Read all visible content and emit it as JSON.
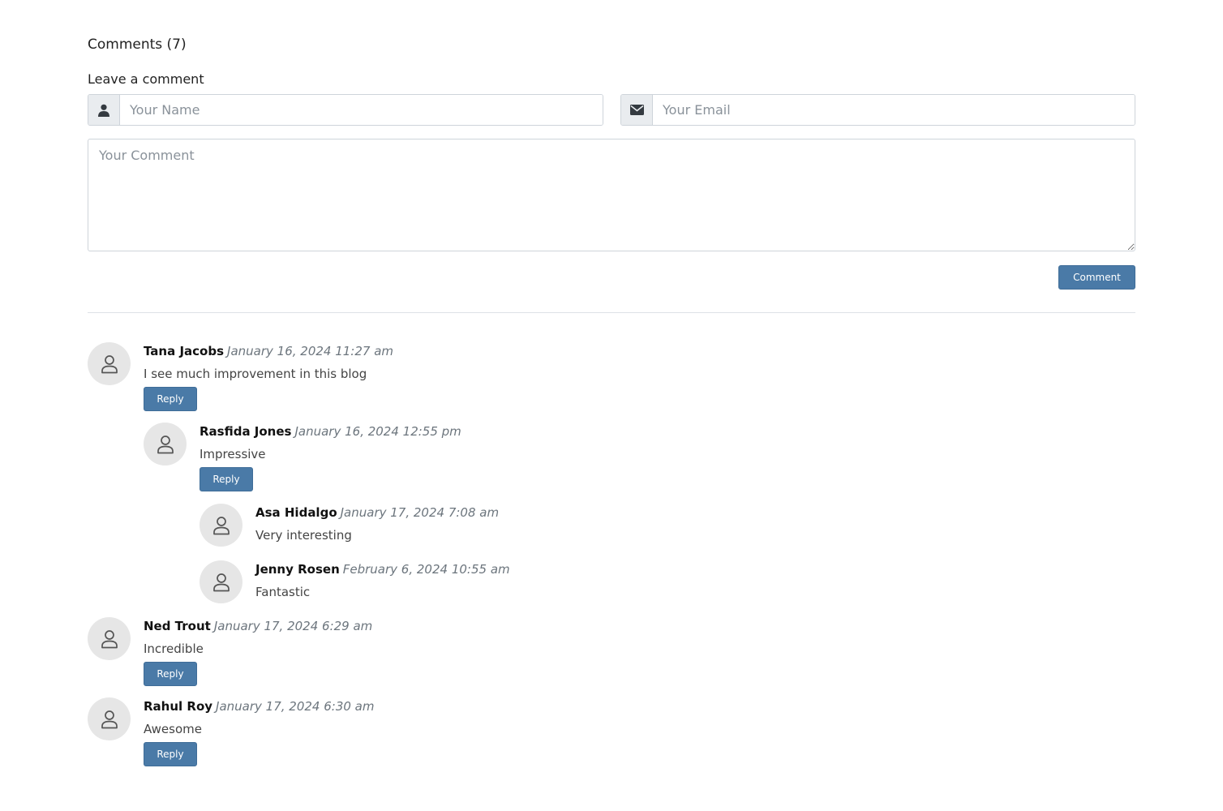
{
  "comments_heading": "Comments (7)",
  "form": {
    "title": "Leave a comment",
    "name_placeholder": "Your Name",
    "email_placeholder": "Your Email",
    "comment_placeholder": "Your Comment",
    "submit_label": "Comment",
    "user_icon": "user-icon",
    "email_icon": "envelope-icon"
  },
  "colors": {
    "button": "#4a7aa7",
    "avatar_bg": "#e6e6e6"
  },
  "reply_label": "Reply",
  "comments": [
    {
      "author": "Tana Jacobs",
      "date": "January 16, 2024 11:27 am",
      "text": "I see much improvement in this blog",
      "level": 0,
      "has_reply": true
    },
    {
      "author": "Rasfida Jones",
      "date": "January 16, 2024 12:55 pm",
      "text": "Impressive",
      "level": 1,
      "has_reply": true
    },
    {
      "author": "Asa Hidalgo",
      "date": "January 17, 2024 7:08 am",
      "text": "Very interesting",
      "level": 2,
      "has_reply": false
    },
    {
      "author": "Jenny Rosen",
      "date": "February 6, 2024 10:55 am",
      "text": "Fantastic",
      "level": 2,
      "has_reply": false
    },
    {
      "author": "Ned Trout",
      "date": "January 17, 2024 6:29 am",
      "text": "Incredible",
      "level": 0,
      "has_reply": true
    },
    {
      "author": "Rahul Roy",
      "date": "January 17, 2024 6:30 am",
      "text": "Awesome",
      "level": 0,
      "has_reply": true
    }
  ]
}
